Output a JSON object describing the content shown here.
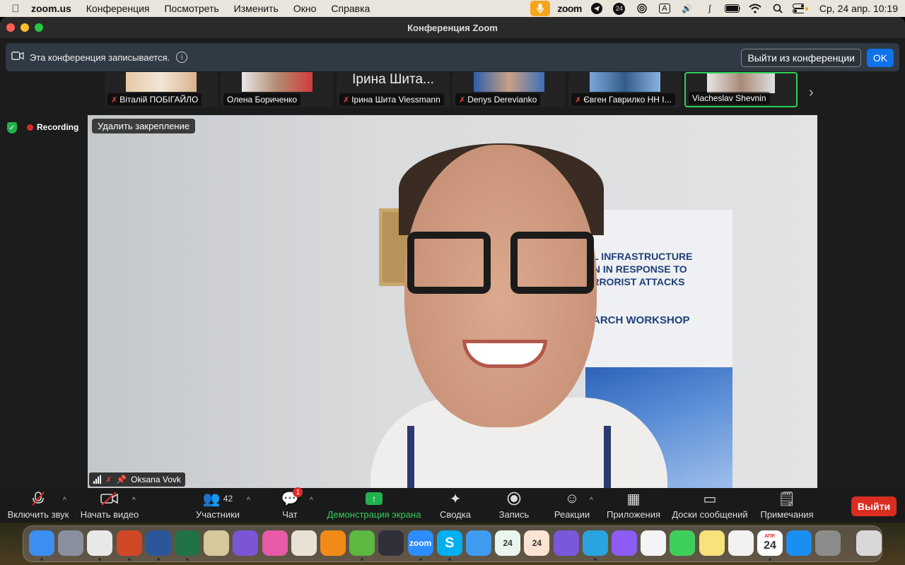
{
  "menubar": {
    "app_name": "zoom.us",
    "items": [
      "Конференция",
      "Посмотреть",
      "Изменить",
      "Окно",
      "Справка"
    ],
    "tray_zoom": "zoom",
    "tray_24": "24",
    "tray_input": "A",
    "clock": "Ср, 24 апр.  10:19"
  },
  "window": {
    "title": "Конференция Zoom"
  },
  "recording_banner": {
    "text": "Эта конференция записывается.",
    "leave_button": "Выйти из конференции",
    "ok_button": "OK"
  },
  "thumbnails": [
    {
      "name": "Віталій ПОБІГАЙЛО",
      "muted": true
    },
    {
      "name": "Олена Бориченко",
      "muted": false
    },
    {
      "name": "Ірина Шита Viessmann",
      "muted": true,
      "display_name": "Ірина Шита..."
    },
    {
      "name": "Denys Derevianko",
      "muted": true
    },
    {
      "name": "Євген Гаврилко НН І...",
      "muted": true
    },
    {
      "name": "Viacheslav Shevnin",
      "muted": false,
      "active": true
    }
  ],
  "status": {
    "recording": "Recording"
  },
  "main_video": {
    "unpin_label": "Удалить закрепление",
    "speaker": "Oksana Vovk",
    "poster_lines": [
      "AL INFRASTRUCTURE",
      "ON IN RESPONSE TO",
      "ERRORIST ATTACKS",
      "EARCH WORKSHOP"
    ]
  },
  "toolbar": {
    "unmute": "Включить звук",
    "start_video": "Начать видео",
    "participants": "Участники",
    "participants_count": "42",
    "chat": "Чат",
    "chat_badge": "1",
    "share": "Демонстрация экрана",
    "summary": "Сводка",
    "record": "Запись",
    "reactions": "Реакции",
    "apps": "Приложения",
    "whiteboards": "Доски сообщений",
    "notes": "Примечания",
    "leave": "Выйти"
  },
  "dock": {
    "icons": [
      {
        "name": "finder",
        "color": "#3d8ef0"
      },
      {
        "name": "launchpad",
        "color": "#8a8fa0"
      },
      {
        "name": "chrome",
        "color": "#e8e8e8"
      },
      {
        "name": "powerpoint",
        "color": "#d24726"
      },
      {
        "name": "word",
        "color": "#2b579a"
      },
      {
        "name": "excel",
        "color": "#217346"
      },
      {
        "name": "preview",
        "color": "#d6c89a"
      },
      {
        "name": "translate",
        "color": "#7a56d6"
      },
      {
        "name": "pixelmator",
        "color": "#e65aa6"
      },
      {
        "name": "books",
        "color": "#e8e1d4"
      },
      {
        "name": "infuse",
        "color": "#f28a18"
      },
      {
        "name": "utorrent",
        "color": "#5bb840"
      },
      {
        "name": "quicktime",
        "color": "#30303a"
      },
      {
        "name": "zoom",
        "color": "#2d8cff",
        "label": "zoom"
      },
      {
        "name": "skype",
        "color": "#00aff0",
        "label": "S"
      },
      {
        "name": "mail",
        "color": "#3f9bf0"
      },
      {
        "name": "24-app",
        "color": "#e9f6ee",
        "label": "24"
      },
      {
        "name": "24-app-2",
        "color": "#fde3d3",
        "label": "24"
      },
      {
        "name": "viber",
        "color": "#7b57d9"
      },
      {
        "name": "telegram",
        "color": "#2aa3e0"
      },
      {
        "name": "messenger",
        "color": "#8d5cf5"
      },
      {
        "name": "google-drive",
        "color": "#f4f4f4"
      },
      {
        "name": "messages",
        "color": "#3ecf5a"
      },
      {
        "name": "notes",
        "color": "#f8e27a"
      },
      {
        "name": "photos",
        "color": "#f2f2f2"
      },
      {
        "name": "calendar",
        "color": "#ffffff",
        "label": "24",
        "month": "АПР."
      },
      {
        "name": "app-store",
        "color": "#1b8ef2"
      },
      {
        "name": "system-settings",
        "color": "#8c8c8c"
      },
      {
        "name": "trash",
        "color": "#d8d8d8"
      }
    ]
  }
}
